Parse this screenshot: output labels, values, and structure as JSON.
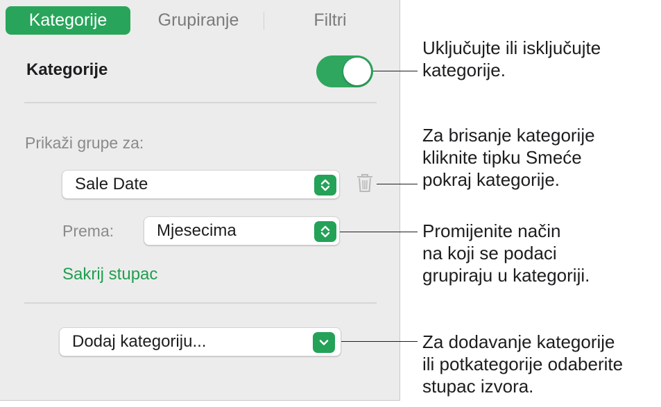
{
  "tabs": [
    {
      "label": "Kategorije",
      "active": true
    },
    {
      "label": "Grupiranje",
      "active": false
    },
    {
      "label": "Filtri",
      "active": false
    }
  ],
  "categories_section": {
    "title": "Kategorije",
    "toggle_on": true
  },
  "show_groups_label": "Prikaži grupe za:",
  "group_popup": {
    "value": "Sale Date"
  },
  "by_label": "Prema:",
  "by_popup": {
    "value": "Mjesecima"
  },
  "hide_column_link": "Sakrij stupac",
  "add_category_popup": {
    "value": "Dodaj kategoriju..."
  },
  "callouts": {
    "toggle": "Uključujte ili isključujte\nkategorije.",
    "delete": "Za brisanje kategorije\nkliknite tipku Smeće\npokraj kategorije.",
    "grouping": "Promijenite način\nna koji se podaci\ngrupiraju u kategoriji.",
    "add": "Za dodavanje kategorije\nili potkategorije odaberite\nstupac izvora."
  },
  "colors": {
    "accent": "#28a55a",
    "link": "#1f9e50",
    "panel_bg": "#ececec"
  },
  "icons": {
    "delete": "trash-icon",
    "stepper": "up-down-chevron-icon",
    "dropdown": "chevron-down-icon"
  }
}
